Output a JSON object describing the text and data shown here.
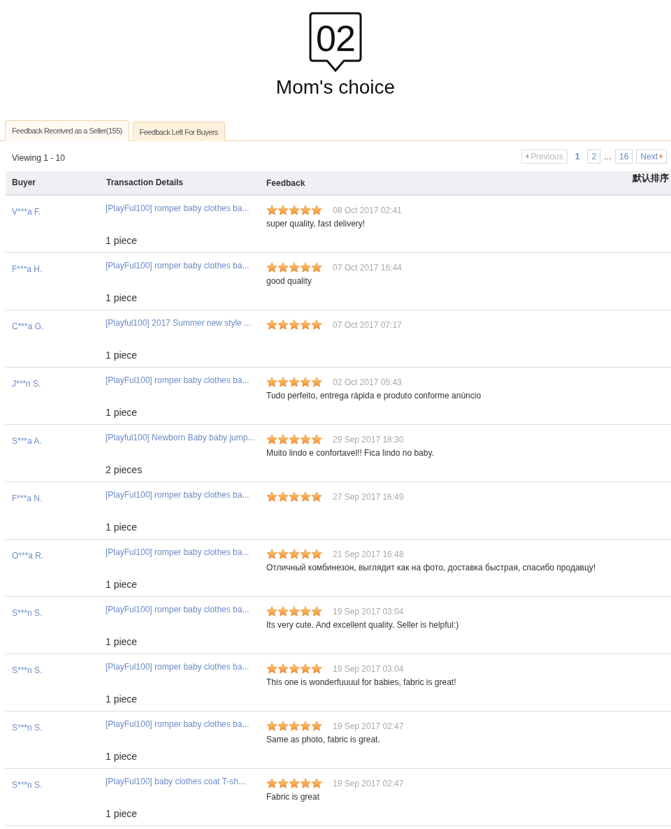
{
  "badge": {
    "number": "02"
  },
  "title": "Mom's choice",
  "tabs": [
    {
      "label": "Feedback Received as a Seller(155)",
      "selected": true
    },
    {
      "label": "Feedback Left For Buyers",
      "selected": false
    }
  ],
  "viewing": "Viewing 1 - 10",
  "pagination": {
    "previous": {
      "label": "Previous",
      "disabled": true
    },
    "pages": [
      {
        "kind": "page",
        "label": "1",
        "selected": true
      },
      {
        "kind": "page",
        "label": "2",
        "selected": false
      },
      {
        "kind": "ellipsis",
        "label": "..."
      },
      {
        "kind": "page",
        "label": "16",
        "selected": false
      }
    ],
    "next": {
      "label": "Next",
      "disabled": false
    }
  },
  "table": {
    "columns": [
      "Buyer",
      "Transaction Details",
      "Feedback"
    ],
    "sort_label": "默认排序",
    "rows": [
      {
        "buyer": "V***a F.",
        "item": "[PlayFul100] romper baby clothes ba...",
        "quantity": "1 piece",
        "stars": 5,
        "date": "08 Oct 2017 02:41",
        "comment": "super quality, fast delivery!"
      },
      {
        "buyer": "F***a H.",
        "item": "[PlayFul100] romper baby clothes ba...",
        "quantity": "1 piece",
        "stars": 5,
        "date": "07 Oct 2017 16:44",
        "comment": "good quality"
      },
      {
        "buyer": "C***a G.",
        "item": "[Playful100] 2017 Summer new style ...",
        "quantity": "1 piece",
        "stars": 5,
        "date": "07 Oct 2017 07:17"
      },
      {
        "buyer": "J***n S.",
        "item": "[PlayFul100] romper baby clothes ba...",
        "quantity": "1 piece",
        "stars": 5,
        "date": "02 Oct 2017 05:43",
        "comment": "Tudo perfeito, entrega rápida e produto conforme anúncio"
      },
      {
        "buyer": "S***a A.",
        "item": "[Playful100] Newborn Baby baby jump...",
        "quantity": "2 pieces",
        "stars": 5,
        "date": "29 Sep 2017 18:30",
        "comment": "Muito lindo e confortavel!! Fica lindo no baby."
      },
      {
        "buyer": "F***a N.",
        "item": "[PlayFul100] romper baby clothes ba...",
        "quantity": "1 piece",
        "stars": 5,
        "date": "27 Sep 2017 16:49"
      },
      {
        "buyer": "O***a R.",
        "item": "[PlayFul100] romper baby clothes ba...",
        "quantity": "1 piece",
        "stars": 5,
        "date": "21 Sep 2017 16:48",
        "comment": "Отличный комбинезон, выглядит как на фото, доставка быстрая, спасибо продавцу!"
      },
      {
        "buyer": "S***n S.",
        "item": "[PlayFul100] romper baby clothes ba...",
        "quantity": "1 piece",
        "stars": 5,
        "date": "19 Sep 2017 03:04",
        "comment": "Its very cute. And excellent quality. Seller is helpful:)"
      },
      {
        "buyer": "S***n S.",
        "item": "[PlayFul100] romper baby clothes ba...",
        "quantity": "1 piece",
        "stars": 5,
        "date": "19 Sep 2017 03:04",
        "comment": "This one is wonderfuuuul for babies, fabric is great!"
      },
      {
        "buyer": "S***n S.",
        "item": "[PlayFul100] romper baby clothes ba...",
        "quantity": "1 piece",
        "stars": 5,
        "date": "19 Sep 2017 02:47",
        "comment": "Same as photo, fabric is great."
      },
      {
        "buyer": "S***n S.",
        "item": "[PlayFul100] baby clothes coat T-sh...",
        "quantity": "1 piece",
        "stars": 5,
        "date": "19 Sep 2017 02:47",
        "comment": "Fabric is great"
      }
    ]
  }
}
